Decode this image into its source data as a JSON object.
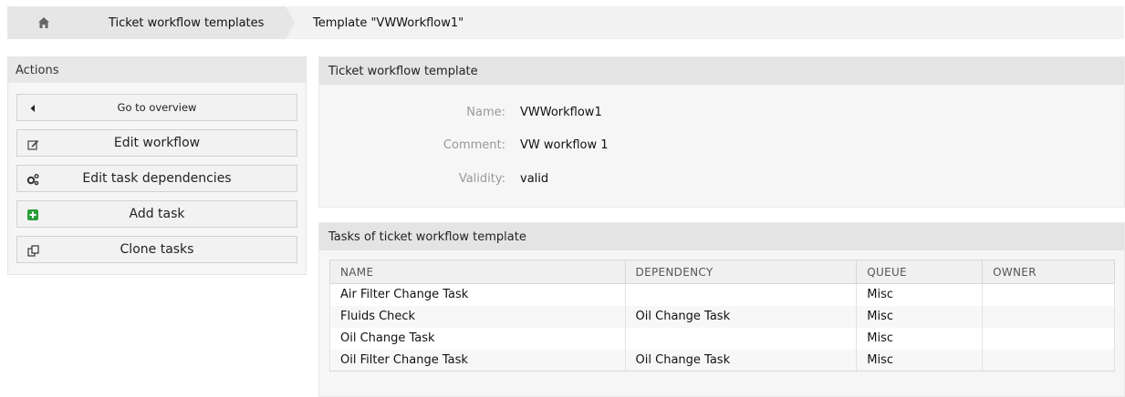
{
  "breadcrumb": {
    "home_icon": "home-icon",
    "items": [
      "Ticket workflow templates",
      "Template \"VWWorkflow1\""
    ]
  },
  "sidebar": {
    "title": "Actions",
    "actions": [
      {
        "label": "Go to overview",
        "icon": "caret-left-icon"
      },
      {
        "label": "Edit workflow",
        "icon": "edit-icon"
      },
      {
        "label": "Edit task dependencies",
        "icon": "gears-icon"
      },
      {
        "label": "Add task",
        "icon": "plus-square-icon"
      },
      {
        "label": "Clone tasks",
        "icon": "copy-icon"
      }
    ]
  },
  "template_panel": {
    "title": "Ticket workflow template",
    "fields": [
      {
        "label": "Name:",
        "value": "VWWorkflow1"
      },
      {
        "label": "Comment:",
        "value": "VW workflow 1"
      },
      {
        "label": "Validity:",
        "value": "valid"
      }
    ]
  },
  "tasks_panel": {
    "title": "Tasks of ticket workflow template",
    "columns": [
      "NAME",
      "DEPENDENCY",
      "QUEUE",
      "OWNER"
    ],
    "rows": [
      {
        "name": "Air Filter Change Task",
        "dependency": "",
        "queue": "Misc",
        "owner": ""
      },
      {
        "name": "Fluids Check",
        "dependency": "Oil Change Task",
        "queue": "Misc",
        "owner": ""
      },
      {
        "name": "Oil Change Task",
        "dependency": "",
        "queue": "Misc",
        "owner": ""
      },
      {
        "name": "Oil Filter Change Task",
        "dependency": "Oil Change Task",
        "queue": "Misc",
        "owner": ""
      }
    ]
  },
  "colors": {
    "link": "#1f4e8f",
    "add_icon": "#2a9d3a"
  }
}
